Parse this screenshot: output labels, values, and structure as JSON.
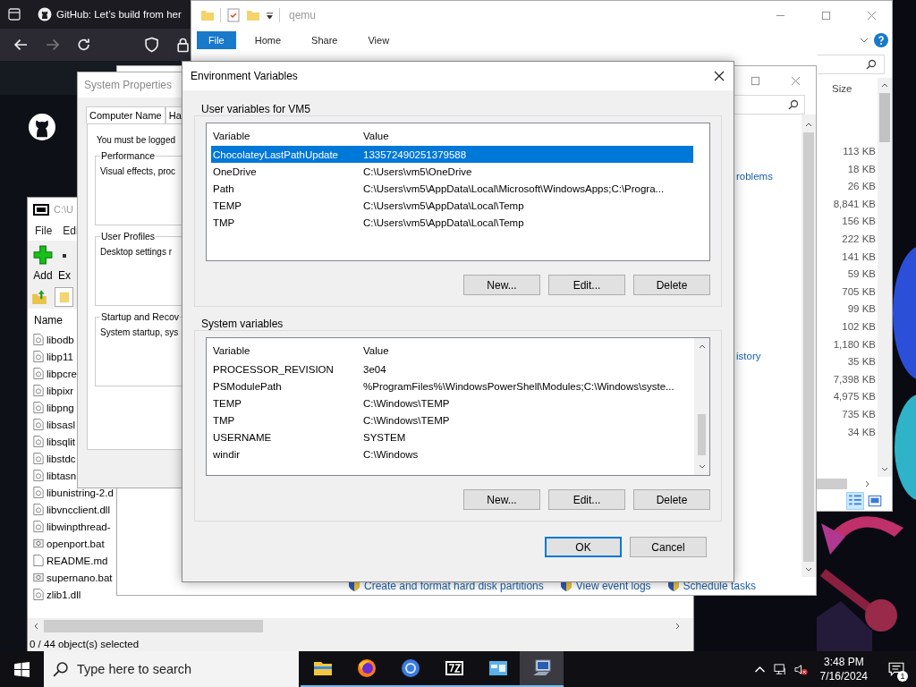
{
  "browser": {
    "tab_title": "GitHub: Let’s build from her"
  },
  "explorer": {
    "title": "qemu",
    "ribbon_tabs": [
      {
        "label": "File",
        "selected": true
      },
      {
        "label": "Home",
        "selected": false
      },
      {
        "label": "Share",
        "selected": false
      },
      {
        "label": "View",
        "selected": false
      }
    ],
    "size_header": "Size",
    "sizes": [
      "113 KB",
      "18 KB",
      "26 KB",
      "8,841 KB",
      "156 KB",
      "222 KB",
      "141 KB",
      "59 KB",
      "705 KB",
      "99 KB",
      "102 KB",
      "1,180 KB",
      "35 KB",
      "7,398 KB",
      "4,975 KB",
      "735 KB",
      "34 KB"
    ]
  },
  "archive_manager": {
    "title": "C:\\U",
    "menu": [
      "File",
      "Edi"
    ],
    "toolbar": [
      "Add",
      "Ex"
    ],
    "name_header": "Name",
    "files": [
      {
        "name": "libodb",
        "kind": "dll"
      },
      {
        "name": "libp11",
        "kind": "dll"
      },
      {
        "name": "libpcre",
        "kind": "dll"
      },
      {
        "name": "libpixr",
        "kind": "dll"
      },
      {
        "name": "libpng",
        "kind": "dll"
      },
      {
        "name": "libsasl",
        "kind": "dll"
      },
      {
        "name": "libsqlit",
        "kind": "dll"
      },
      {
        "name": "libstdc",
        "kind": "dll"
      },
      {
        "name": "libtasn",
        "kind": "dll"
      },
      {
        "name": "libunistring-2.d",
        "kind": "dll"
      },
      {
        "name": "libvncclient.dll",
        "kind": "dll"
      },
      {
        "name": "libwinpthread-",
        "kind": "dll"
      },
      {
        "name": "openport.bat",
        "kind": "bat"
      },
      {
        "name": "README.md",
        "kind": "text"
      },
      {
        "name": "supernano.bat",
        "kind": "bat"
      },
      {
        "name": "zlib1.dll",
        "kind": "dll"
      }
    ],
    "status": "0 / 44 object(s) selected"
  },
  "computer_management": {
    "links": [
      "roblems",
      "istory"
    ],
    "tasks": [
      "Create and format hard disk partitions",
      "View event logs",
      "Schedule tasks"
    ]
  },
  "system_properties": {
    "title": "System Properties",
    "tabs": [
      "Computer Name",
      "Ha"
    ],
    "intro": "You must be logged",
    "groups": [
      {
        "title": "Performance",
        "text": "Visual effects, proc"
      },
      {
        "title": "User Profiles",
        "text": "Desktop settings r"
      },
      {
        "title": "Startup and Recov",
        "text": "System startup, sys"
      }
    ]
  },
  "environment_variables": {
    "title": "Environment Variables",
    "user_group": "User variables for VM5",
    "system_group": "System variables",
    "user_columns": [
      "Variable",
      "Value"
    ],
    "system_columns": [
      "Variable",
      "Value"
    ],
    "user_rows": [
      {
        "variable": "ChocolateyLastPathUpdate",
        "value": "133572490251379588",
        "selected": true
      },
      {
        "variable": "OneDrive",
        "value": "C:\\Users\\vm5\\OneDrive",
        "selected": false
      },
      {
        "variable": "Path",
        "value": "C:\\Users\\vm5\\AppData\\Local\\Microsoft\\WindowsApps;C:\\Progra...",
        "selected": false
      },
      {
        "variable": "TEMP",
        "value": "C:\\Users\\vm5\\AppData\\Local\\Temp",
        "selected": false
      },
      {
        "variable": "TMP",
        "value": "C:\\Users\\vm5\\AppData\\Local\\Temp",
        "selected": false
      }
    ],
    "system_rows": [
      {
        "variable": "PROCESSOR_REVISION",
        "value": "3e04",
        "selected": false
      },
      {
        "variable": "PSModulePath",
        "value": "%ProgramFiles%\\WindowsPowerShell\\Modules;C:\\Windows\\syste...",
        "selected": false
      },
      {
        "variable": "TEMP",
        "value": "C:\\Windows\\TEMP",
        "selected": false
      },
      {
        "variable": "TMP",
        "value": "C:\\Windows\\TEMP",
        "selected": false
      },
      {
        "variable": "USERNAME",
        "value": "SYSTEM",
        "selected": false
      },
      {
        "variable": "windir",
        "value": "C:\\Windows",
        "selected": false
      }
    ],
    "user_buttons": [
      "New...",
      "Edit...",
      "Delete"
    ],
    "system_buttons": [
      "New...",
      "Edit...",
      "Delete"
    ],
    "ok": "OK",
    "cancel": "Cancel"
  },
  "taskbar": {
    "search_placeholder": "Type here to search",
    "apps": [
      {
        "kind": "explorer",
        "active": false
      },
      {
        "kind": "firefox",
        "active": false
      },
      {
        "kind": "chrome",
        "active": false
      },
      {
        "kind": "archiver",
        "active": false
      },
      {
        "kind": "control",
        "active": false
      },
      {
        "kind": "system",
        "active": true
      }
    ],
    "time": "3:48 PM",
    "date": "7/16/2024",
    "notifications": "1"
  }
}
